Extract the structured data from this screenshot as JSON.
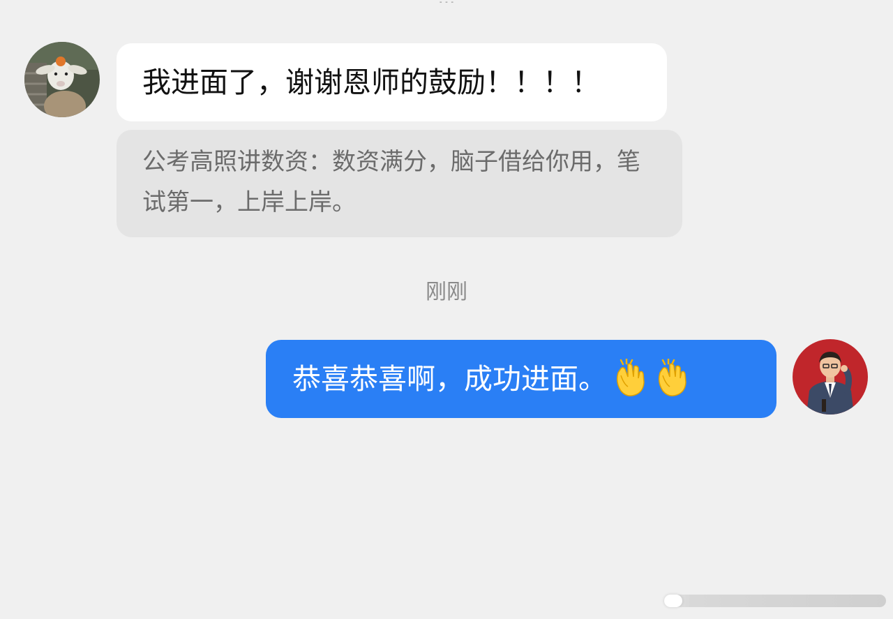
{
  "messages": {
    "incoming": {
      "text": "我进面了，谢谢恩师的鼓励！！！！",
      "avatar_icon": "lamb-avatar"
    },
    "quote": {
      "text": "公考高照讲数资：数资满分，脑子借给你用，笔试第一，上岸上岸。"
    },
    "timestamp": "刚刚",
    "outgoing": {
      "text": "恭喜恭喜啊，成功进面。",
      "emoji": [
        "clapping-hands-icon",
        "clapping-hands-icon"
      ],
      "avatar_icon": "man-in-suit-avatar"
    }
  },
  "colors": {
    "background": "#f0f0f0",
    "incoming_bubble": "#ffffff",
    "quote_bubble": "#e4e4e4",
    "outgoing_bubble": "#2a7ff5",
    "right_avatar_bg": "#c0262b"
  }
}
